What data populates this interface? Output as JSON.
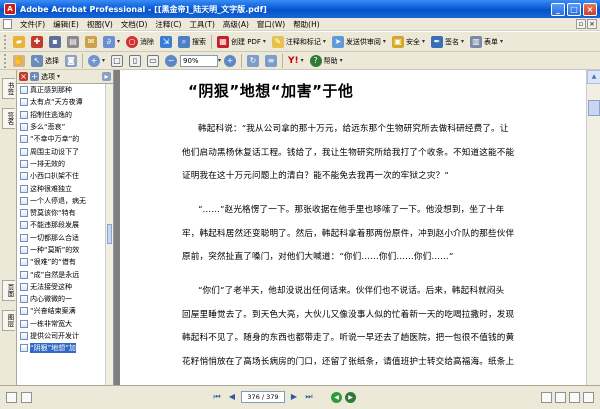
{
  "window": {
    "title": "Adobe Acrobat Professional - [[黑金帝]_陆天明_文字版.pdf]",
    "app_icon_label": "A",
    "minimize": "_",
    "maximize": "□",
    "close": "×"
  },
  "menu": {
    "items": [
      "文件(F)",
      "编辑(E)",
      "视图(V)",
      "文档(D)",
      "注释(C)",
      "工具(T)",
      "高级(A)",
      "窗口(W)",
      "帮助(H)"
    ],
    "restore": "▫",
    "close": "×"
  },
  "toolbar1": {
    "erase_label": "消除",
    "search_label": "搜索",
    "create_pdf_label": "创建 PDF",
    "comment_label": "注释和标记",
    "send_label": "发送供审阅",
    "secure_label": "安全",
    "sign_label": "签名",
    "forms_label": "表单"
  },
  "toolbar2": {
    "select_label": "选择",
    "zoom_value": "90%",
    "help_label": "帮助"
  },
  "navtabs": [
    "书签",
    "签名",
    "页面",
    "图层"
  ],
  "bookmarks": {
    "header_label": "选项",
    "items": [
      "真正感到那种",
      "太有点“天方夜谭",
      "招制住逃逸的",
      "多么“悲哀”",
      "“不幸中万幸”的",
      "周围主动设下了",
      "一排无效的",
      "小西口扒架不住",
      "这种很难独立",
      "一个人停退，病无",
      "赞莫该你“特有",
      "不能违那段发展",
      "一切都那么合适",
      "一种“莫斯”的效",
      "“很难”的“借有",
      "“成”自然是永远",
      "无法接受这种",
      "内心微微的一",
      "“兴奋结束案满",
      "一栋非常宽大",
      "提供公司开发计",
      "“阴狠”地想“加"
    ],
    "selected_index": 21
  },
  "document": {
    "title": "“阴狠”地想“加害”于他",
    "paragraphs": [
      [
        "韩起科说：“我从公司拿的那十万元，给远东那个生物研究所去做科研经费了。让",
        "他们启动黑杨休复话工程。钱给了，我让生物研究所给我打了个收条。不知道这能不能",
        "证明我在这十万元问题上的清白？能不能免去我再一次的牢狱之灾？”"
      ],
      [
        "“……”赵光格愣了一下。那张收据在他手里也哆嗦了一下。他没想到，坐了十年",
        "牢，韩起科居然还变聪明了。然后，韩起科拿着那两份原件，冲到赵小介队的那些伙伴",
        "原前，突然扯直了嗓门，对他们大喊道：“你们……你们……你们……”"
      ],
      [
        "“你们”了老半天，他却没说出任何话来。伙伴们也不说话。后来，韩起科就闷头",
        "回屋里睡觉去了。到天色大亮，大伙儿又像没事人似的忙着新一天的吃喝拉撒时，发现",
        "韩起科不见了。随身的东西也都带走了。听说一早还去了趟医院，把一包很不值钱的黄",
        "花籽悄悄放在了高场长病房的门口，还留了张纸条，请值班护士转交给高福海。纸条上"
      ]
    ]
  },
  "statusbar": {
    "page_display": "376 / 379",
    "first": "⏮",
    "prev": "◀",
    "next": "▶",
    "last": "⏭",
    "back": "◀",
    "forward": "▶"
  }
}
